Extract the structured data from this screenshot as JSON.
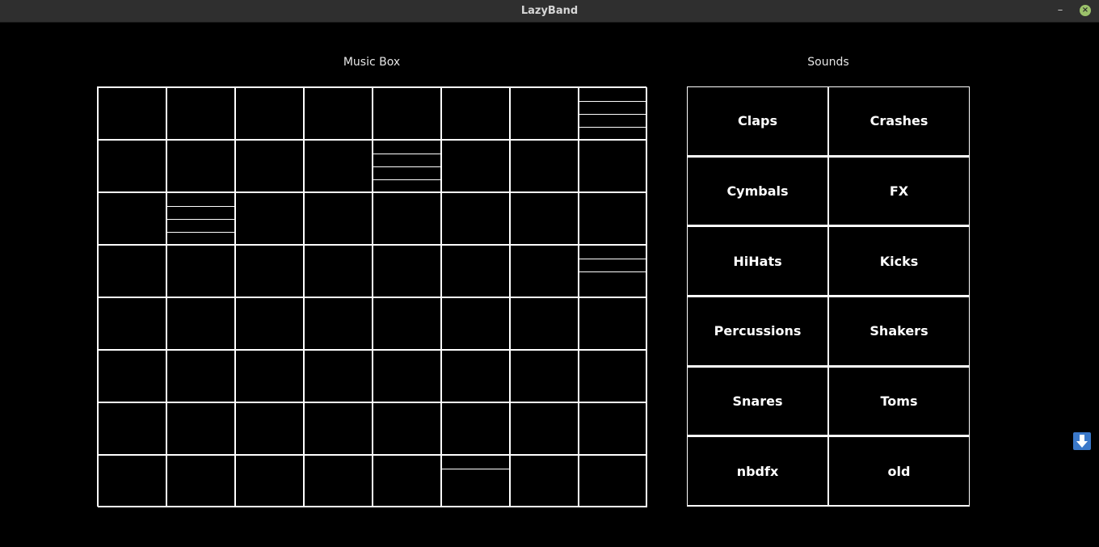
{
  "window": {
    "title": "LazyBand",
    "minimize_label": "–",
    "close_label": "×"
  },
  "music_box": {
    "title": "Music Box",
    "rows": 8,
    "cols": 8,
    "segments": [
      {
        "row": 0,
        "col": 7,
        "count": 3
      },
      {
        "row": 1,
        "col": 4,
        "count": 3
      },
      {
        "row": 2,
        "col": 1,
        "count": 4
      },
      {
        "row": 3,
        "col": 7,
        "count": 2
      },
      {
        "row": 7,
        "col": 5,
        "count": 1
      }
    ]
  },
  "sounds": {
    "title": "Sounds",
    "items": [
      {
        "label": "Claps"
      },
      {
        "label": "Crashes"
      },
      {
        "label": "Cymbals"
      },
      {
        "label": "FX"
      },
      {
        "label": "HiHats"
      },
      {
        "label": "Kicks"
      },
      {
        "label": "Percussions"
      },
      {
        "label": "Shakers"
      },
      {
        "label": "Snares"
      },
      {
        "label": "Toms"
      },
      {
        "label": "nbdfx"
      },
      {
        "label": "old"
      }
    ]
  },
  "download_button": {
    "icon": "down-arrow-icon",
    "color": "#3a78c9"
  }
}
